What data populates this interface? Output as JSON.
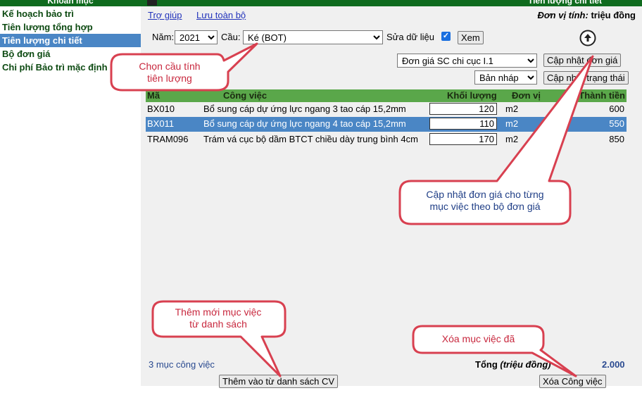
{
  "sidebar": {
    "header": "Khoản mục",
    "items": [
      {
        "label": "Kế hoạch bảo trì",
        "active": false
      },
      {
        "label": "Tiên lượng tổng hợp",
        "active": false
      },
      {
        "label": "Tiên lượng chi tiết",
        "active": true
      },
      {
        "label": "Bộ đơn giá",
        "active": false
      },
      {
        "label": "Chi phí Bảo trì mặc định",
        "active": false
      }
    ]
  },
  "header": {
    "title": "Tiên lượng chi tiết",
    "help_link": "Trợ giúp",
    "save_all_link": "Lưu toàn bộ",
    "unit_label": "Đơn vị tính:",
    "unit_value": "triệu đồng"
  },
  "filters": {
    "year_label": "Năm:",
    "year_value": "2021",
    "bridge_label": "Cầu:",
    "bridge_value": "Ké (BOT)",
    "edit_label": "Sửa dữ liệu",
    "edit_checked": true,
    "view_button": "Xem"
  },
  "actions": {
    "price_set_value": "Đơn giá SC chi cục I.1",
    "update_price_button": "Cập nhật đơn giá",
    "status_value": "Bản nháp",
    "update_status_button": "Cập nhật trạng thái",
    "upload_icon": "upload-circle-icon"
  },
  "table": {
    "columns": [
      "Mã",
      "Công việc",
      "Khối lượng",
      "Đơn vị",
      "Thành tiền"
    ],
    "rows": [
      {
        "code": "BX010",
        "task": "Bổ sung cáp dự ứng lực ngang 3 tao cáp 15,2mm",
        "qty": "120",
        "unit": "m2",
        "amount": "600",
        "selected": false
      },
      {
        "code": "BX011",
        "task": "Bổ sung cáp dự ứng lực ngang 4 tao cáp 15,2mm",
        "qty": "110",
        "unit": "m2",
        "amount": "550",
        "selected": true
      },
      {
        "code": "TRAM096",
        "task": "Trám vá cục bộ dầm BTCT chiều dày trung bình 4cm",
        "qty": "170",
        "unit": "m2",
        "amount": "850",
        "selected": false
      }
    ]
  },
  "footer": {
    "count_text": "3 mục công việc",
    "total_label": "Tổng",
    "total_unit": "(triệu đồng)",
    "total_value": "2.000",
    "add_button": "Thêm vào từ danh sách CV",
    "delete_button": "Xóa Công việc"
  },
  "callouts": {
    "choose_bridge": "Chọn cầu tính\ntiên lượng",
    "update_price": "Cập nhật đơn giá cho từng\nmục việc theo bộ đơn giá",
    "add_new": "Thêm mới mục việc\ntừ danh sách",
    "delete_item": "Xóa mục việc đã"
  },
  "colors": {
    "header_green": "#0f6b1e",
    "table_header_green": "#5aa74a",
    "selected_blue": "#4a86c5",
    "callout_red_border": "#d84050",
    "link_blue": "#2233bb"
  }
}
